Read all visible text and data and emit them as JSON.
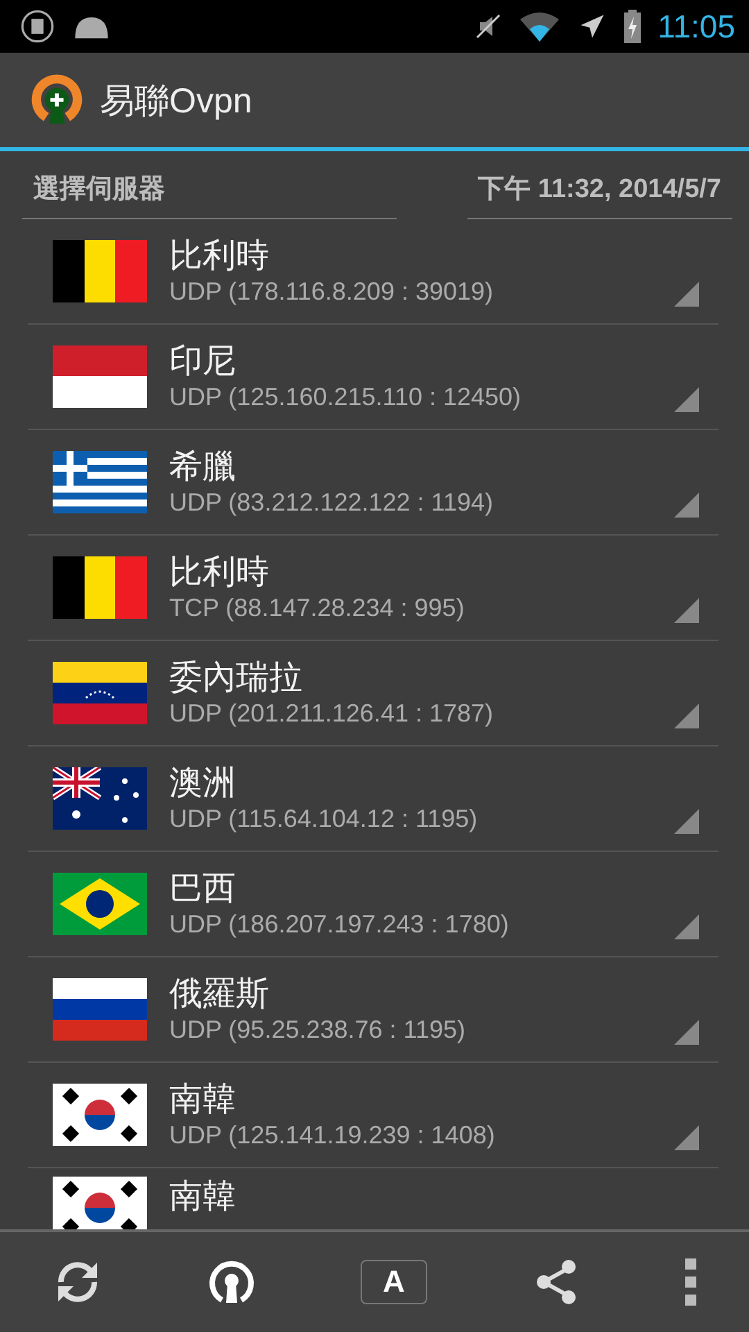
{
  "status_bar": {
    "time": "11:05"
  },
  "app_bar": {
    "title": "易聯Ovpn"
  },
  "header": {
    "label": "選擇伺服器",
    "timestamp": "下午 11:32, 2014/5/7"
  },
  "servers": [
    {
      "kind": "belgium",
      "name": "比利時",
      "address": "UDP (178.116.8.209 : 39019)"
    },
    {
      "kind": "indonesia",
      "name": "印尼",
      "address": "UDP (125.160.215.110 : 12450)"
    },
    {
      "kind": "greece",
      "name": "希臘",
      "address": "UDP (83.212.122.122 : 1194)"
    },
    {
      "kind": "belgium",
      "name": "比利時",
      "address": "TCP (88.147.28.234 : 995)"
    },
    {
      "kind": "venezuela",
      "name": "委內瑞拉",
      "address": "UDP (201.211.126.41 : 1787)"
    },
    {
      "kind": "australia",
      "name": "澳洲",
      "address": "UDP (115.64.104.12 : 1195)"
    },
    {
      "kind": "brazil",
      "name": "巴西",
      "address": "UDP (186.207.197.243 : 1780)"
    },
    {
      "kind": "russia",
      "name": "俄羅斯",
      "address": "UDP (95.25.238.76 : 1195)"
    },
    {
      "kind": "korea",
      "name": "南韓",
      "address": "UDP (125.141.19.239 : 1408)"
    },
    {
      "kind": "korea",
      "name": "南韓"
    }
  ],
  "bottom_bar": {
    "font_button": "A"
  }
}
